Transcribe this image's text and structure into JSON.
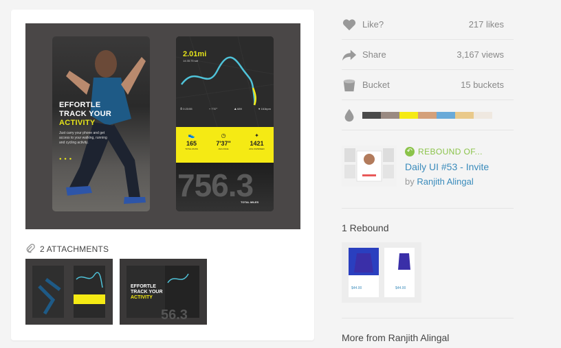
{
  "shot": {
    "left_phone": {
      "headline": [
        "EFFORTLE",
        "TRACK YOUR",
        "ACTIVITY"
      ],
      "subtext": "Just carry your phone and get access to your walking, running and cycling activity.",
      "pager": "● ● ●"
    },
    "right_phone": {
      "distance": "2.01mi",
      "time": "14:35:75 sat",
      "meta": [
        "⏱ 0:23:55",
        "⌁ 7'37\"",
        "⛰ 68ft",
        "♥ 161bpm"
      ],
      "stats": [
        {
          "icon": "👟",
          "value": "165",
          "label": "TOTAL RUNS"
        },
        {
          "icon": "◷",
          "value": "7'37\"",
          "label": "AVG PACE"
        },
        {
          "icon": "✦",
          "value": "1421",
          "label": "AVG KM/SPEED"
        }
      ],
      "big_number": "756.3",
      "total_label": "TOTAL MILES"
    }
  },
  "attachments": {
    "label": "2 ATTACHMENTS"
  },
  "sidebar": {
    "like": {
      "label": "Like?",
      "value": "217 likes"
    },
    "share": {
      "label": "Share",
      "value": "3,167 views"
    },
    "bucket": {
      "label": "Bucket",
      "value": "15 buckets"
    },
    "palette": [
      "#4a4a4a",
      "#9a8a82",
      "#f5ea14",
      "#d4a07a",
      "#6aaad8",
      "#e9c98a",
      "#efe8e0"
    ],
    "rebound_of": {
      "title": "REBOUND OF...",
      "link": "Daily UI #53 - Invite",
      "by": "by",
      "author": "Ranjith Alingal"
    },
    "rebounds_heading": "1 Rebound",
    "more_from": "More from Ranjith Alingal",
    "rebound_prices": [
      "$44.00",
      "$44.00"
    ]
  },
  "colors": {
    "accent_yellow": "#f5ea14",
    "link_blue": "#3a8bbb",
    "rebound_green": "#8bc34a"
  }
}
